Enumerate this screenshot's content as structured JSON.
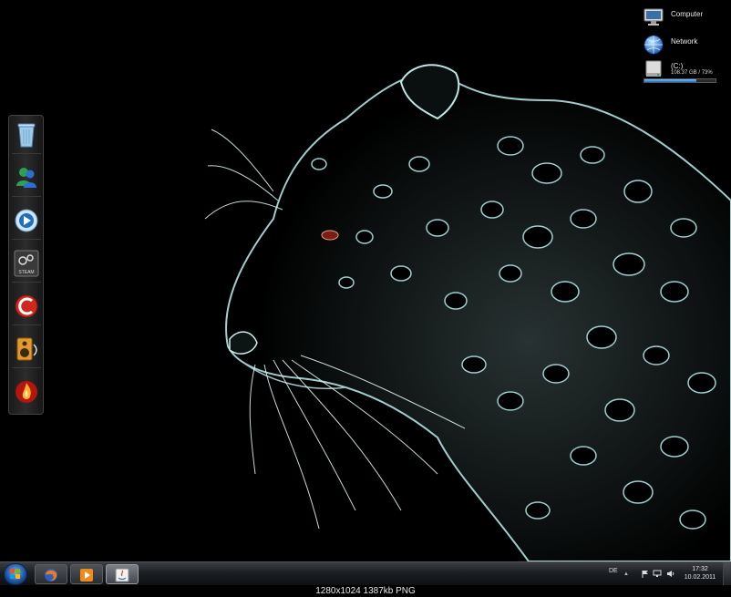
{
  "desktop": {
    "icons": [
      {
        "label": "Computer",
        "icon": "computer-icon"
      },
      {
        "label": "Network",
        "icon": "network-globe-icon"
      },
      {
        "label": "(C:)",
        "icon": "drive-c-icon",
        "info": "108.37 GB / 73%",
        "usage": 0.73
      }
    ]
  },
  "dock": {
    "items": [
      {
        "name": "recycle-bin-icon"
      },
      {
        "name": "messenger-icon"
      },
      {
        "name": "media-player-icon"
      },
      {
        "name": "steam-icon",
        "label": "STEAM"
      },
      {
        "name": "ccleaner-icon"
      },
      {
        "name": "audio-speaker-icon"
      },
      {
        "name": "fire-app-icon"
      }
    ]
  },
  "taskbar": {
    "pinned": [
      {
        "name": "firefox-icon"
      },
      {
        "name": "media-player-icon"
      },
      {
        "name": "java-icon"
      }
    ],
    "language": "DE",
    "time": "17:32",
    "date": "10.02.2011"
  },
  "caption": "1280x1024  1387kb  PNG",
  "colors": {
    "accent": "#1d6fd1",
    "fur": "#a9d9d9"
  }
}
